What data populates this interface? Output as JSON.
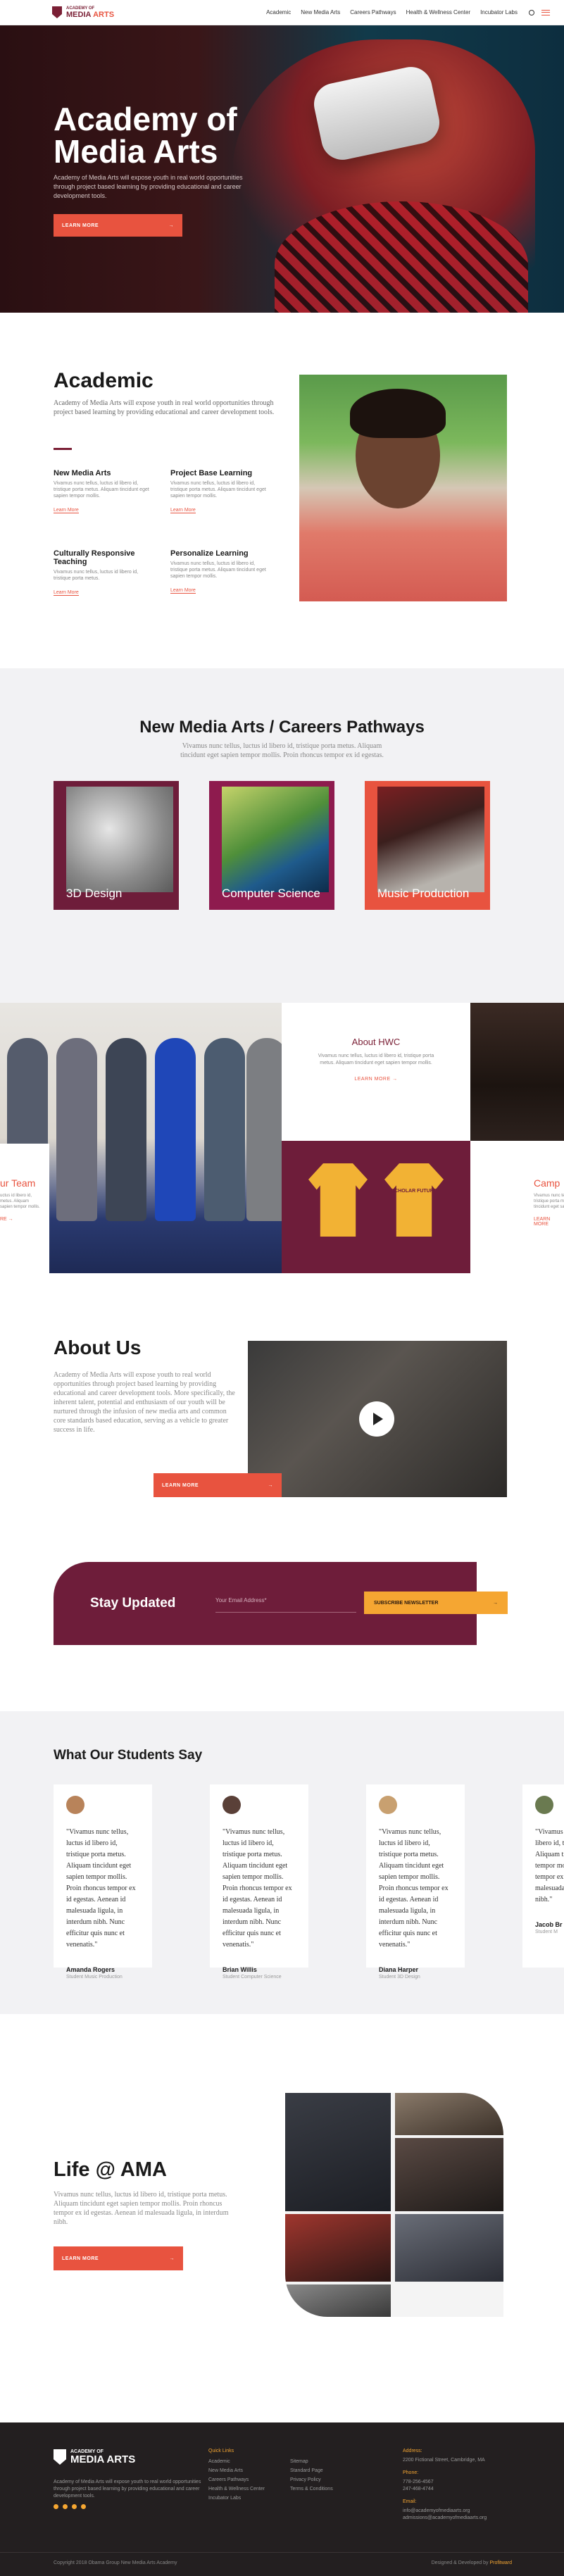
{
  "nav": {
    "logo_top": "ACADEMY OF",
    "logo_main_1": "MEDIA",
    "logo_main_2": "ARTS",
    "links": [
      "Academic",
      "New Media Arts",
      "Careers Pathways",
      "Health & Wellness Center",
      "Incubator Labs"
    ]
  },
  "hero": {
    "title_line1": "Academy of",
    "title_line2": "Media Arts",
    "text": "Academy of Media Arts will expose youth in real world opportunities through project based learning by providing educational and career development tools.",
    "cta": "LEARN MORE",
    "arrow": "→"
  },
  "academic": {
    "title": "Academic",
    "intro": "Academy of Media Arts will expose youth in real world opportunities through project based learning by providing educational and career development tools.",
    "features": [
      {
        "title": "New Media Arts",
        "text": "Vivamus nunc tellus, luctus id libero id, tristique porta metus. Aliquam tincidunt eget sapien tempor mollis.",
        "link": "Learn More"
      },
      {
        "title": "Project Base Learning",
        "text": "Vivamus nunc tellus, luctus id libero id, tristique porta metus. Aliquam tincidunt eget sapien tempor mollis.",
        "link": "Learn More"
      },
      {
        "title": "Culturally Responsive Teaching",
        "text": "Vivamus nunc tellus, luctus id libero id, tristique porta metus.",
        "link": "Learn More"
      },
      {
        "title": "Personalize Learning",
        "text": "Vivamus nunc tellus, luctus id libero id, tristique porta metus. Aliquam tincidunt eget sapien tempor mollis.",
        "link": "Learn More"
      }
    ]
  },
  "pathways": {
    "title": "New Media Arts / Careers Pathways",
    "subtitle": "Vivamus nunc tellus, luctus id libero id, tristique porta metus. Aliquam tincidunt eget sapien tempor mollis. Proin rhoncus tempor ex id egestas.",
    "cards": [
      {
        "label": "3D Design",
        "color": "#6e1d3a"
      },
      {
        "label": "Computer Science",
        "color": "#8e1b4e"
      },
      {
        "label": "Music Production",
        "color": "#e8533f"
      }
    ]
  },
  "strip": {
    "team_label": "ur Team",
    "team_text": "uctus id libero id, metus. Aliquam sapien tempor mollis.",
    "team_link": "RE  →",
    "hwc_title": "About HWC",
    "hwc_text": "Vivamus nunc tellus, luctus id libero id, tristique porta metus. Aliquam tincidunt eget sapien tempor mollis.",
    "hwc_link": "LEARN MORE  →",
    "shirt_text": "SCHOLAR FUTURE",
    "camp_label": "Camp",
    "camp_text": "Vivamus nunc tellu tristique porta metus tincidunt eget sapien",
    "camp_link": "LEARN MORE"
  },
  "about": {
    "title": "About Us",
    "text": "Academy of Media Arts will expose youth to real world opportunities through project based learning by providing educational and career development tools. More specifically, the inherent talent, potential and enthusiasm of our youth will be nurtured through the infusion of new media arts and common core standards based education, serving as a vehicle to greater success in life.",
    "cta": "LEARN MORE",
    "arrow": "→"
  },
  "newsletter": {
    "title": "Stay Updated",
    "placeholder": "Your Email Address*",
    "button": "SUBSCRIBE NEWSLETTER",
    "arrow": "→"
  },
  "testimonials": {
    "title": "What Our Students Say",
    "items": [
      {
        "quote": "\"Vivamus nunc tellus, luctus id libero id, tristique porta metus. Aliquam tincidunt eget sapien tempor mollis. Proin rhoncus tempor ex id egestas. Aenean id malesuada ligula, in interdum nibh. Nunc efficitur quis nunc et venenatis.\"",
        "name": "Amanda Rogers",
        "role": "Student Music Production",
        "avatar": "#b8835a"
      },
      {
        "quote": "\"Vivamus nunc tellus, luctus id libero id, tristique porta metus. Aliquam tincidunt eget sapien tempor mollis. Proin rhoncus tempor ex id egestas. Aenean id malesuada ligula, in interdum nibh. Nunc efficitur quis nunc et venenatis.\"",
        "name": "Brian Willis",
        "role": "Student Computer Science",
        "avatar": "#5a4038"
      },
      {
        "quote": "\"Vivamus nunc tellus, luctus id libero id, tristique porta metus. Aliquam tincidunt eget sapien tempor mollis. Proin rhoncus tempor ex id egestas. Aenean id malesuada ligula, in interdum nibh. Nunc efficitur quis nunc et venenatis.\"",
        "name": "Diana Harper",
        "role": "Student 3D Design",
        "avatar": "#c8a070"
      },
      {
        "quote": "\"Vivamus nunc tellus, luctus id libero id, tristique porta metus. Aliquam tincidunt eget sapien tempor mollis. Proin rhoncus tempor ex id egestas. Aenean id malesuada ligula, in interdum nibh.\"",
        "name": "Jacob Br",
        "role": "Student M",
        "avatar": "#6a7a50"
      }
    ]
  },
  "life": {
    "title": "Life @ AMA",
    "text": "Vivamus nunc tellus, luctus id libero id, tristique porta metus. Aliquam tincidunt eget sapien tempor mollis. Proin rhoncus tempor ex id egestas. Aenean id malesuada ligula, in interdum nibh.",
    "cta": "LEARN MORE",
    "arrow": "→"
  },
  "footer": {
    "logo_top": "ACADEMY OF",
    "logo_main": "MEDIA ARTS",
    "desc": "Academy of Media Arts will expose youth to real world opportunities through project based learning by providing educational and career development tools.",
    "col1_title": "Quick Links",
    "col1": [
      "Academic",
      "New Media Arts",
      "Careers Pathways",
      "Health & Wellness Center",
      "Incubator Labs"
    ],
    "col2_title": "",
    "col2": [
      "Sitemap",
      "Standard Page",
      "Privacy Policy",
      "Terms & Conditions"
    ],
    "address_title": "Address:",
    "address": "2200 Fictional Street, Cambridge, MA",
    "phone_title": "Phone:",
    "phone": "778-256-4567\n247-468-4744",
    "email_title": "Email:",
    "email": "info@academyofmediaarts.org\nadmissions@academyofmediaarts.org",
    "copyright": "Copyright 2018 Obama Group New Media Arts Academy",
    "credit_prefix": "Designed & Developed by",
    "credit": "Profitward"
  }
}
